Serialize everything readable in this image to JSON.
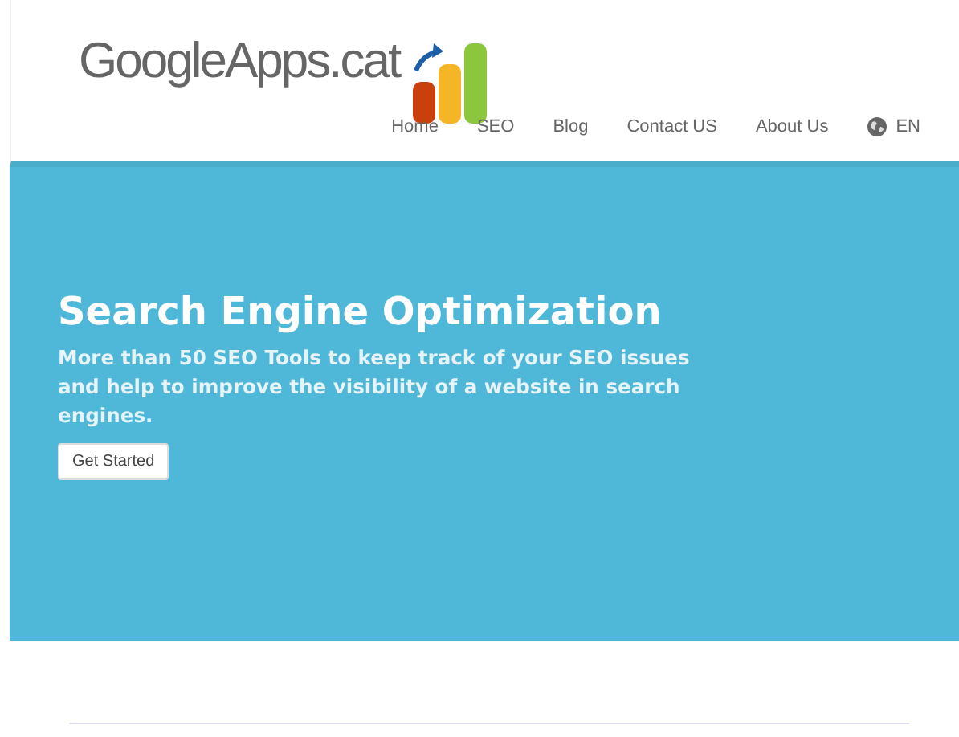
{
  "logo": {
    "text": "GoogleApps.cat"
  },
  "nav": {
    "items": [
      "Home",
      "SEO",
      "Blog",
      "Contact US",
      "About Us"
    ],
    "language": "EN"
  },
  "hero": {
    "title": "Search Engine Optimization",
    "subtitle": "More than 50 SEO Tools to keep track of your SEO issues and help to improve the visibility of a website in search engines.",
    "button": "Get Started"
  }
}
